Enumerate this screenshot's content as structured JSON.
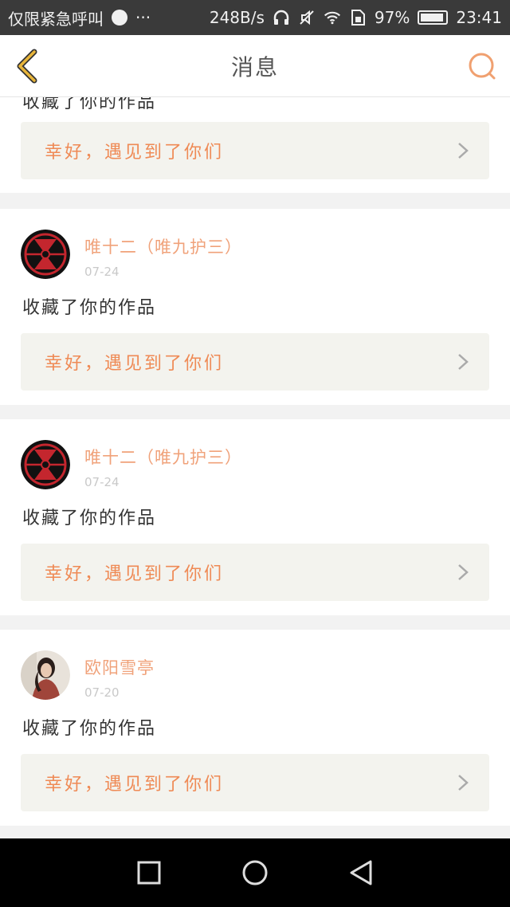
{
  "status_bar": {
    "carrier": "仅限紧急呼叫",
    "dots": "···",
    "speed": "248B/s",
    "battery_pct": "97%",
    "battery_level": 0.97,
    "time": "23:41",
    "icons": [
      "globe-icon",
      "headphones-icon",
      "mute-icon",
      "wifi-icon",
      "sim-icon",
      "battery-icon"
    ]
  },
  "header": {
    "title": "消息",
    "accent": "#e8b53a",
    "search_color": "#f0a070"
  },
  "first_card": {
    "partial_text": "收藏了你的作品",
    "work_title": "幸好，遇见到了你们"
  },
  "messages": [
    {
      "user": "唯十二（唯九护三）",
      "date": "07-24",
      "action": "收藏了你的作品",
      "work_title": "幸好，遇见到了你们",
      "avatar": "exo-logo-avatar"
    },
    {
      "user": "唯十二（唯九护三）",
      "date": "07-24",
      "action": "收藏了你的作品",
      "work_title": "幸好，遇见到了你们",
      "avatar": "exo-logo-avatar"
    },
    {
      "user": "欧阳雪亭",
      "date": "07-20",
      "action": "收藏了你的作品",
      "work_title": "幸好，遇见到了你们",
      "avatar": "photo-avatar"
    }
  ],
  "colors": {
    "username": "#f0a27a",
    "work_title": "#ef8a55",
    "work_bg": "#f3f3ee"
  }
}
